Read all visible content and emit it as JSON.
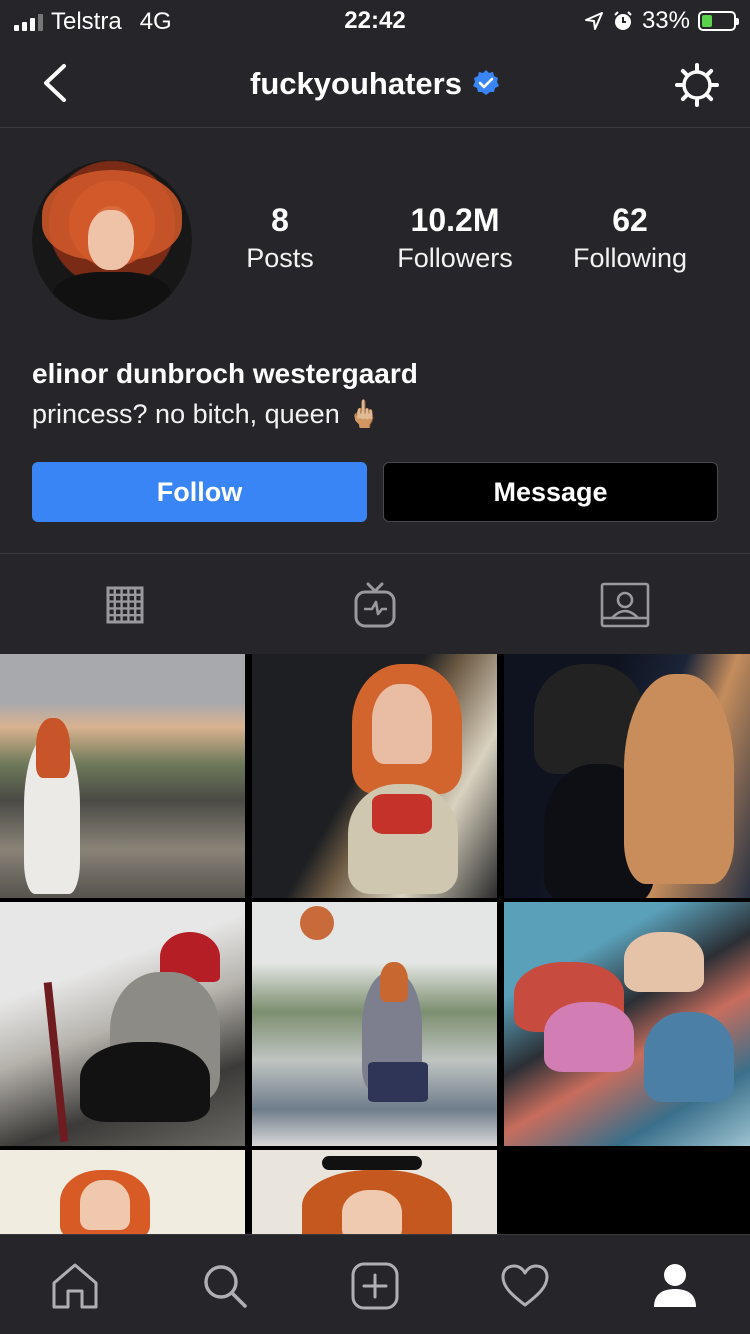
{
  "status_bar": {
    "carrier": "Telstra",
    "network": "4G",
    "time": "22:42",
    "battery": "33%",
    "battery_level": 0.33,
    "battery_color": "#5bd24b"
  },
  "header": {
    "username": "fuckyouhaters",
    "verified_color": "#3a85f6"
  },
  "profile": {
    "stats": [
      {
        "value": "8",
        "label": "Posts"
      },
      {
        "value": "10.2M",
        "label": "Followers"
      },
      {
        "value": "62",
        "label": "Following"
      }
    ],
    "full_name": "elinor dunbroch westergaard",
    "bio": "princess? no bitch, queen 🖕🏼"
  },
  "actions": {
    "follow_label": "Follow",
    "message_label": "Message",
    "follow_color": "#3a85f6"
  },
  "profile_tabs": [
    "grid-icon",
    "igtv-icon",
    "tagged-icon"
  ],
  "bottom_nav": [
    "home-icon",
    "search-icon",
    "new-post-icon",
    "activity-heart-icon",
    "profile-icon"
  ]
}
